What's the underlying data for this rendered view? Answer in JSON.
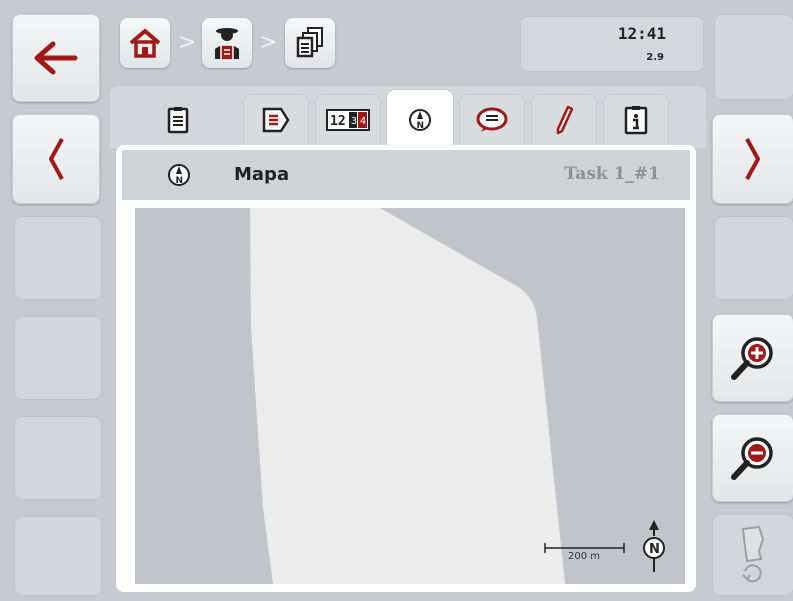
{
  "header": {
    "time": "12:41",
    "version": "2.9",
    "breadcrumb": [
      "home-icon",
      "farmer-icon",
      "tasks-icon"
    ]
  },
  "tabs": [
    "clipboard-icon",
    "task-details-icon",
    "counters-icon",
    "map-icon",
    "notes-icon",
    "edit-icon",
    "info-icon"
  ],
  "active_tab": "map-icon",
  "panel": {
    "title": "Mapa",
    "task_name": "Task 1_#1"
  },
  "map": {
    "scale_label": "200 m",
    "north_label": "N"
  },
  "colors": {
    "accent": "#a01818",
    "background": "#c7cbd0",
    "map_background": "#c2c4cb",
    "field": "#ececec"
  }
}
